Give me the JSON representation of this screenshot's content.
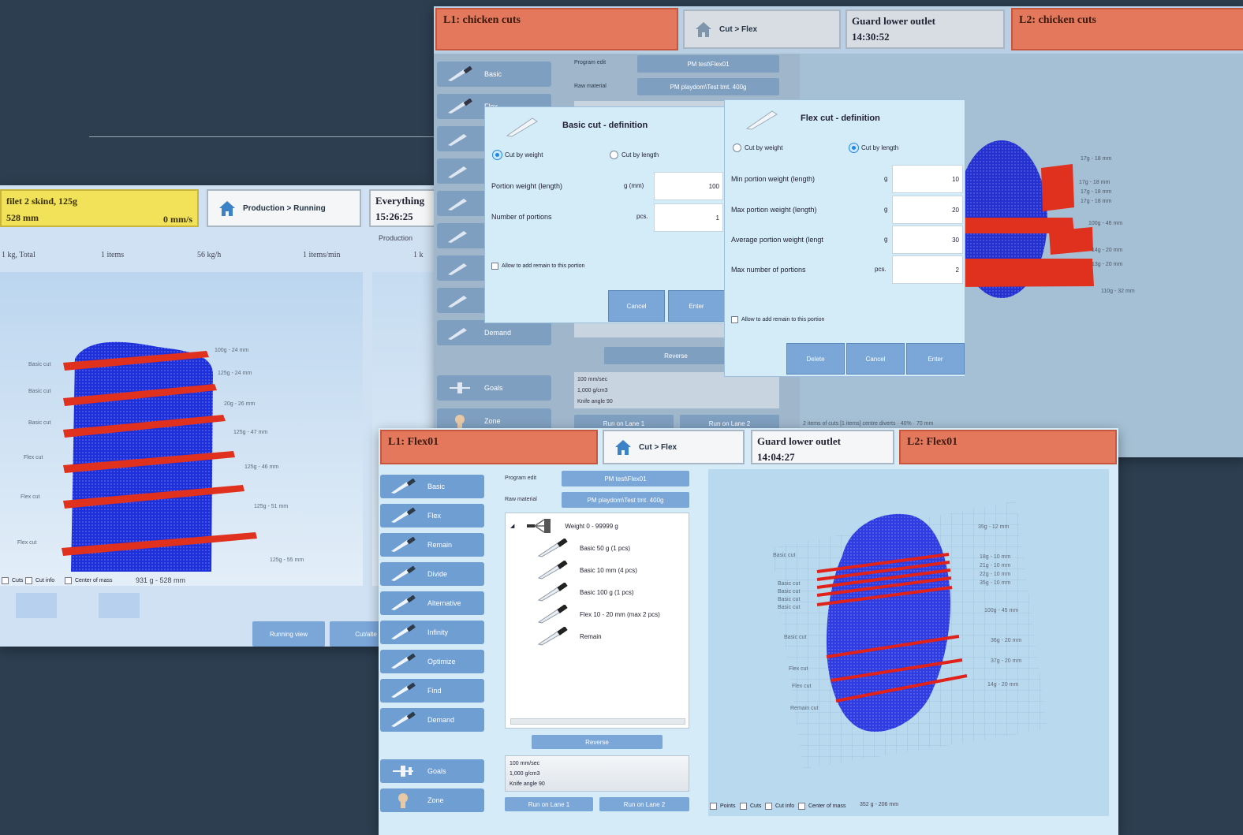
{
  "left": {
    "header": {
      "title": "filet 2 skind, 125g",
      "length": "528 mm",
      "speed": "0 mm/s"
    },
    "crumb": "Production > Running",
    "clock": {
      "title": "Everything",
      "time": "15:26:25"
    },
    "stats": {
      "total": "1 kg, Total",
      "items": "1 items",
      "rate": "56 kg/h",
      "per_min": "1 items/min",
      "partial": "1 k",
      "production": "Production"
    },
    "cut_labels": [
      "Basic cut",
      "Basic cut",
      "Basic cut",
      "Flex cut",
      "Flex cut",
      "Flex cut"
    ],
    "weight_labels": [
      "100g - 24 mm",
      "125g - 24 mm",
      "20g - 26 mm",
      "125g - 47 mm",
      "125g - 46 mm",
      "125g - 51 mm",
      "125g - 55 mm"
    ],
    "footer": {
      "cuts": "Cuts",
      "cut_info": "Cut info",
      "center": "Center of mass",
      "summary": "931 g - 528 mm"
    },
    "buttons": {
      "running": "Running view",
      "other": "Cut/alte"
    }
  },
  "top": {
    "l1": "L1: chicken cuts",
    "crumb": "Cut > Flex",
    "guard": {
      "title": "Guard lower outlet",
      "time": "14:30:52"
    },
    "l2": "L2: chicken cuts",
    "program_label": "Program edit",
    "program_value": "PM test\\Flex01",
    "raw_label": "Raw material",
    "raw_value": "PM playdom\\Test tmt. 400g",
    "reverse": "Reverse",
    "info": [
      "100 mm/sec",
      "1,000 g/cm3",
      "Knife angle 90"
    ],
    "run1": "Run on Lane 1",
    "run2": "Run on Lane 2",
    "side": [
      "Basic",
      "Flex",
      "",
      "",
      "",
      "",
      "",
      "",
      "Demand",
      "Goals",
      "Zone"
    ],
    "side_stats": "2 items of cuts [1 items] centre diverts · 40% · 70 mm",
    "weight_labels": [
      "17g - 18 mm",
      "17g - 18 mm",
      "17g - 18 mm",
      "17g - 18 mm",
      "100g - 46 mm",
      "14g - 20 mm",
      "13g - 20 mm",
      "110g - 32 mm"
    ]
  },
  "basic_dlg": {
    "title": "Basic cut - definition",
    "radio_weight": "Cut by weight",
    "radio_length": "Cut by length",
    "row1": "Portion weight (length)",
    "row1_unit": "g (mm)",
    "row1_val": "100",
    "row2": "Number of portions",
    "row2_unit": "pcs.",
    "row2_val": "1",
    "allow": "Allow to add remain to this portion",
    "cancel": "Cancel",
    "enter": "Enter"
  },
  "flex_dlg": {
    "title": "Flex cut - definition",
    "radio_weight": "Cut by weight",
    "radio_length": "Cut by length",
    "rows": [
      {
        "label": "Min portion weight (length)",
        "unit": "g",
        "val": "10"
      },
      {
        "label": "Max portion weight (length)",
        "unit": "g",
        "val": "20"
      },
      {
        "label": "Average portion weight (lengt",
        "unit": "g",
        "val": "30"
      },
      {
        "label": "Max number of portions",
        "unit": "pcs.",
        "val": "2"
      }
    ],
    "allow": "Allow to add remain to this portion",
    "delete": "Delete",
    "cancel": "Cancel",
    "enter": "Enter"
  },
  "bottom": {
    "l1": "L1: Flex01",
    "crumb": "Cut > Flex",
    "guard": {
      "title": "Guard lower outlet",
      "time": "14:04:27"
    },
    "l2": "L2: Flex01",
    "side": [
      "Basic",
      "Flex",
      "Remain",
      "Divide",
      "Alternative",
      "Infinity",
      "Optimize",
      "Find",
      "Demand",
      "Goals",
      "Zone"
    ],
    "program_label": "Program edit",
    "program_value": "PM test\\Flex01",
    "raw_label": "Raw material",
    "raw_value": "PM playdom\\Test tmt. 400g",
    "tree": [
      "Weight 0 - 99999 g",
      "Basic 50 g (1 pcs)",
      "Basic 10 mm (4 pcs)",
      "Basic 100 g (1 pcs)",
      "Flex 10 - 20 mm (max 2 pcs)",
      "Remain"
    ],
    "reverse": "Reverse",
    "info": [
      "100 mm/sec",
      "1,000 g/cm3",
      "Knife angle 90"
    ],
    "run1": "Run on Lane 1",
    "run2": "Run on Lane 2",
    "cut_labels": [
      "Basic cut",
      "Basic cut",
      "Basic cut",
      "Basic cut",
      "Basic cut",
      "Basic cut",
      "Flex cut",
      "Flex cut",
      "Remain cut"
    ],
    "weight_labels": [
      "35g - 12 mm",
      "18g - 10 mm",
      "21g - 10 mm",
      "22g - 10 mm",
      "35g - 10 mm",
      "100g - 45 mm",
      "36g - 20 mm",
      "37g - 20 mm",
      "14g - 20 mm"
    ],
    "footer": {
      "points": "Points",
      "cuts": "Cuts",
      "cut_info": "Cut info",
      "center": "Center of mass",
      "summary": "352 g - 206 mm"
    }
  }
}
